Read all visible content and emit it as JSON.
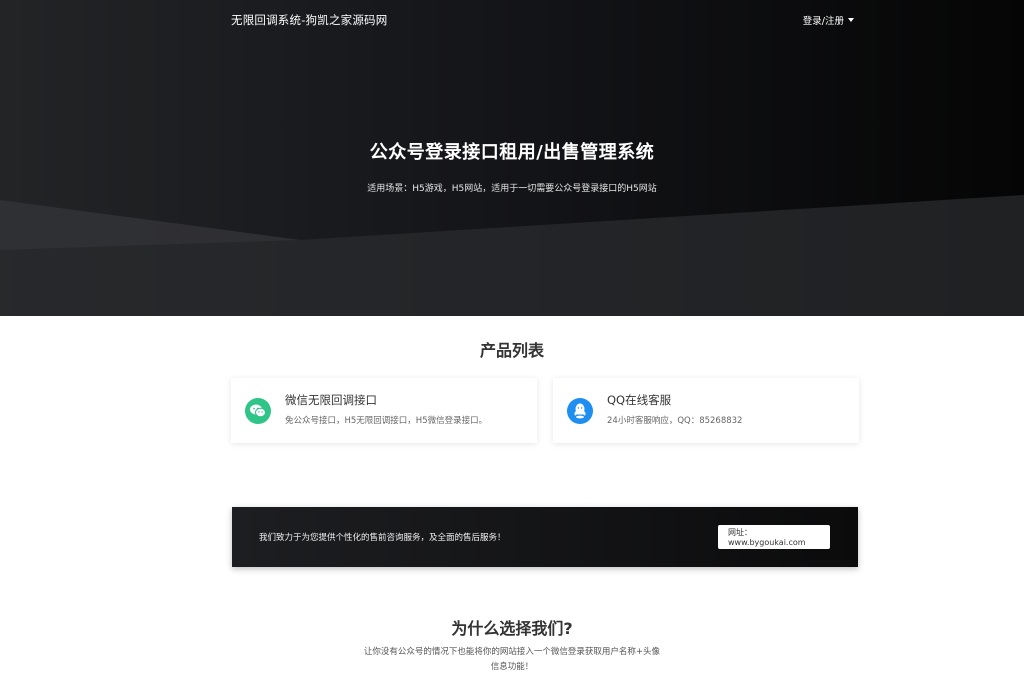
{
  "nav": {
    "brand": "无限回调系统-狗凯之家源码网",
    "login_label": "登录/注册"
  },
  "hero": {
    "title_part1": "公众号登录",
    "title_bold1": "接口",
    "title_part2": "租",
    "title_bold2": "用",
    "title_part3": "/出售管理系统",
    "subtitle": "适用场景：H5游戏，H5网站，适用于一切需要公众号登录接口的H5网站"
  },
  "products": {
    "title": "产品列表",
    "items": [
      {
        "title": "微信无限回调接口",
        "desc": "免公众号接口，H5无限回调接口，H5微信登录接口。",
        "icon": "wechat-icon"
      },
      {
        "title": "QQ在线客服",
        "desc": "24小时客服响应，QQ：85268832",
        "icon": "qq-icon"
      }
    ]
  },
  "banner": {
    "text": "我们致力于为您提供个性化的售前咨询服务，及全面的售后服务！",
    "button_label": "网址：www.bygoukai.com"
  },
  "why": {
    "title": "为什么选择我们?",
    "desc_line1": "让你没有公众号的情况下也能将你的网站接入一个微信登录获取用户名称+头像",
    "desc_line2": "信息功能！"
  },
  "colors": {
    "wechat": "#2fc488",
    "qq": "#1e8ef0",
    "hero_dark": "#050505"
  }
}
